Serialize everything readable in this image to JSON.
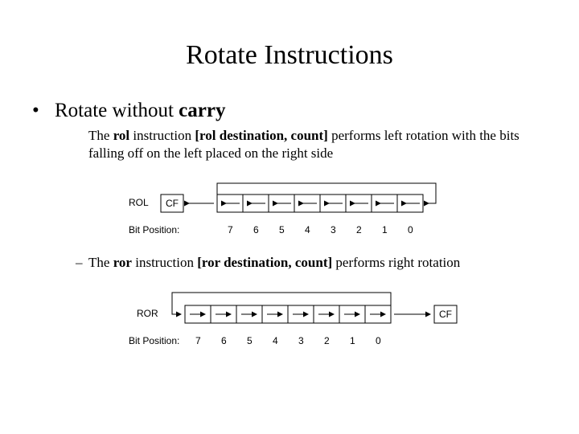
{
  "title": "Rotate Instructions",
  "bullet": {
    "lead": "Rotate without ",
    "bold": "carry"
  },
  "rol": {
    "pre": "The ",
    "kw": "rol",
    "mid": " instruction ",
    "syntax": "[rol destination, count]",
    "post": " performs left rotation with the bits falling off on the left placed on the right side"
  },
  "ror": {
    "pre": "The ",
    "kw": "ror",
    "mid": " instruction ",
    "syntax": "[ror destination, count]",
    "post": " performs right rotation"
  },
  "diagram": {
    "rol_label": "ROL",
    "ror_label": "ROR",
    "cf_label": "CF",
    "bitpos_label": "Bit Position:",
    "bits": [
      "7",
      "6",
      "5",
      "4",
      "3",
      "2",
      "1",
      "0"
    ]
  }
}
